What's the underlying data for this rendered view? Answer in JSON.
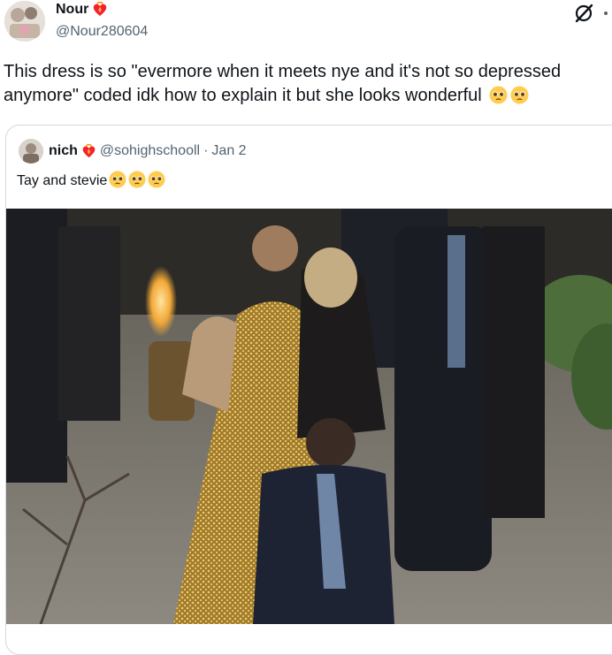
{
  "author": {
    "display_name": "Nour",
    "handle": "@Nour280604"
  },
  "tweet": {
    "text": "This dress is so \"evermore when it meets nye and it's not so depressed anymore\" coded idk how to explain it but she looks wonderful"
  },
  "quoted": {
    "display_name": "nich",
    "handle": "@sohighschooll",
    "separator": "·",
    "date": "Jan 2",
    "text": "Tay and stevie"
  },
  "icons": {
    "name_badge": "heart-fire-icon",
    "grok": "grok-icon",
    "more": "more-dots-icon",
    "emoji": "pleading-face-emoji-icon"
  },
  "colors": {
    "text_primary": "#0f1419",
    "text_secondary": "#536471",
    "border": "#cfd9de",
    "badge_red": "#f4212e",
    "emoji_yellow": "#ffcc4d"
  }
}
